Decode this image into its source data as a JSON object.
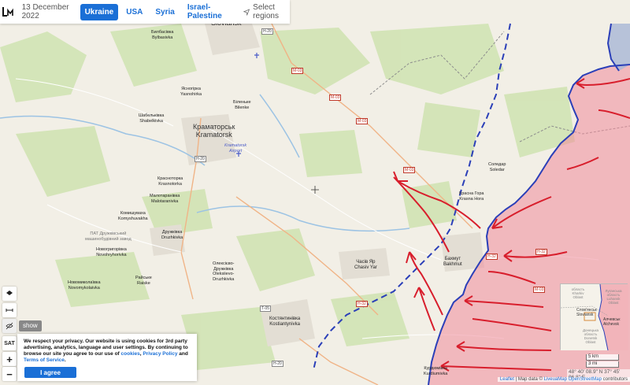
{
  "header": {
    "date": "13 December 2022",
    "tabs": [
      {
        "label": "Ukraine",
        "active": true
      },
      {
        "label": "USA",
        "active": false
      },
      {
        "label": "Syria",
        "active": false
      },
      {
        "label": "Israel-Palestine",
        "active": false
      }
    ],
    "select_regions": "Select regions"
  },
  "controls": {
    "show": "show",
    "sat": "SAT",
    "zoom_in": "+",
    "zoom_out": "−"
  },
  "cities": {
    "sloviansk": "Sloviansk",
    "bylbasivka_uk": "Билбасівка",
    "bylbasivka": "Bylbasivka",
    "yasnohirka_uk": "Ясногірка",
    "yasnohirka": "Yasnohirka",
    "bilenke_uk": "Біленьке",
    "bilenke": "Bilenke",
    "shabelkivka_uk": "Шабельківка",
    "shabelkivka": "Shabelkivka",
    "kramatorsk_uk": "Краматорськ",
    "kramatorsk": "Kramatorsk",
    "airport_1": "Kramatorsk",
    "airport_2": "Airport",
    "krasnotorka_uk": "Красноторка",
    "krasnotorka": "Krasnotorka",
    "malotaranivka_uk": "Малотаранівка",
    "malotaranivka": "Malotaranivka",
    "komyshuvakha_uk": "Комишуваха",
    "komyshuvakha": "Komyshuvakha",
    "druzhkivka_uk": "Дружківка",
    "druzhkivka": "Druzhkivka",
    "pat_druzhk": "ПАТ Дружківський",
    "pat_druzhk_2": "машинобудівний завод",
    "novohryhorivka_uk": "Новогригорівка",
    "novohryhorivka": "Novohryhorivka",
    "raiske_uk": "Райське",
    "raiske": "Raiske",
    "novomykolaivka_uk": "Новомиколаївка",
    "novomykolaivka": "Novomykolaivka",
    "oleksiievo_uk": "Олексієво-",
    "oleksiievo_uk2": "Дружківка",
    "oleksiievo": "Oleksiievo-",
    "oleksiievo2": "Druzhkivka",
    "chasiv_uk": "Часів Яр",
    "chasiv": "Chasiv Yar",
    "kostiantynivka_uk": "Костянтинівка",
    "kostiantynivka": "Kostiantynivka",
    "soledar_uk": "Соледар",
    "soledar": "Soledar",
    "krasna_uk": "Красна Гора",
    "krasna": "Krasna Hora",
    "bakhmut_uk": "Бахмут",
    "bakhmut": "Bakhmut",
    "kurdiumivka_uk": "Курдюмівка",
    "kurdiumivka": "Kurdiumivka"
  },
  "roads": [
    "H-20",
    "M-03",
    "M-03",
    "M-03",
    "M-03",
    "H-20",
    "T-05",
    "H-32",
    "H-32",
    "H-32",
    "M-03",
    "H-20"
  ],
  "cookie": {
    "text_1": "We respect your privacy. Our website is using cookies for 3rd party advertising, analytics, language and user settings. By continuing to browse our site you agree to our use of ",
    "link_cookies": "cookies",
    "sep": ", ",
    "link_privacy": "Privacy Policy",
    "and": " and ",
    "link_terms": "Terms of Service",
    "end": ".",
    "button": "I agree"
  },
  "minimap": {
    "kharkiv_1": "область",
    "kharkiv_2": "Kharkiv",
    "kharkiv_3": "Oblast",
    "luhansk_1": "Луганська",
    "luhansk_2": "область",
    "luhansk_3": "Luhansk",
    "luhansk_4": "Oblast",
    "sloviansk_uk": "Слов'янськ",
    "sloviansk": "Sloviansk",
    "alchevsk_uk": "Алчевськ",
    "alchevsk": "Alchevsk",
    "donetsk_1": "Донецька",
    "donetsk_2": "область",
    "donetsk_3": "Donetsk",
    "donetsk_4": "Oblast"
  },
  "scale": {
    "km": "5 km",
    "mi": "3 mi"
  },
  "coords": "48° 40' 08.9\" N 37° 45' 06.8\" E",
  "attribution": {
    "leaflet": "Leaflet",
    "rest": " | Map data © ",
    "osm": "LiveuaMap OpenStreetMap",
    "contrib": " contributors"
  },
  "colors": {
    "accent": "#1a6fd6",
    "occupied": "#f08a9a",
    "frontline": "#2b3fb8",
    "arrow": "#d81e2c",
    "map_bg": "#f2efe6"
  }
}
